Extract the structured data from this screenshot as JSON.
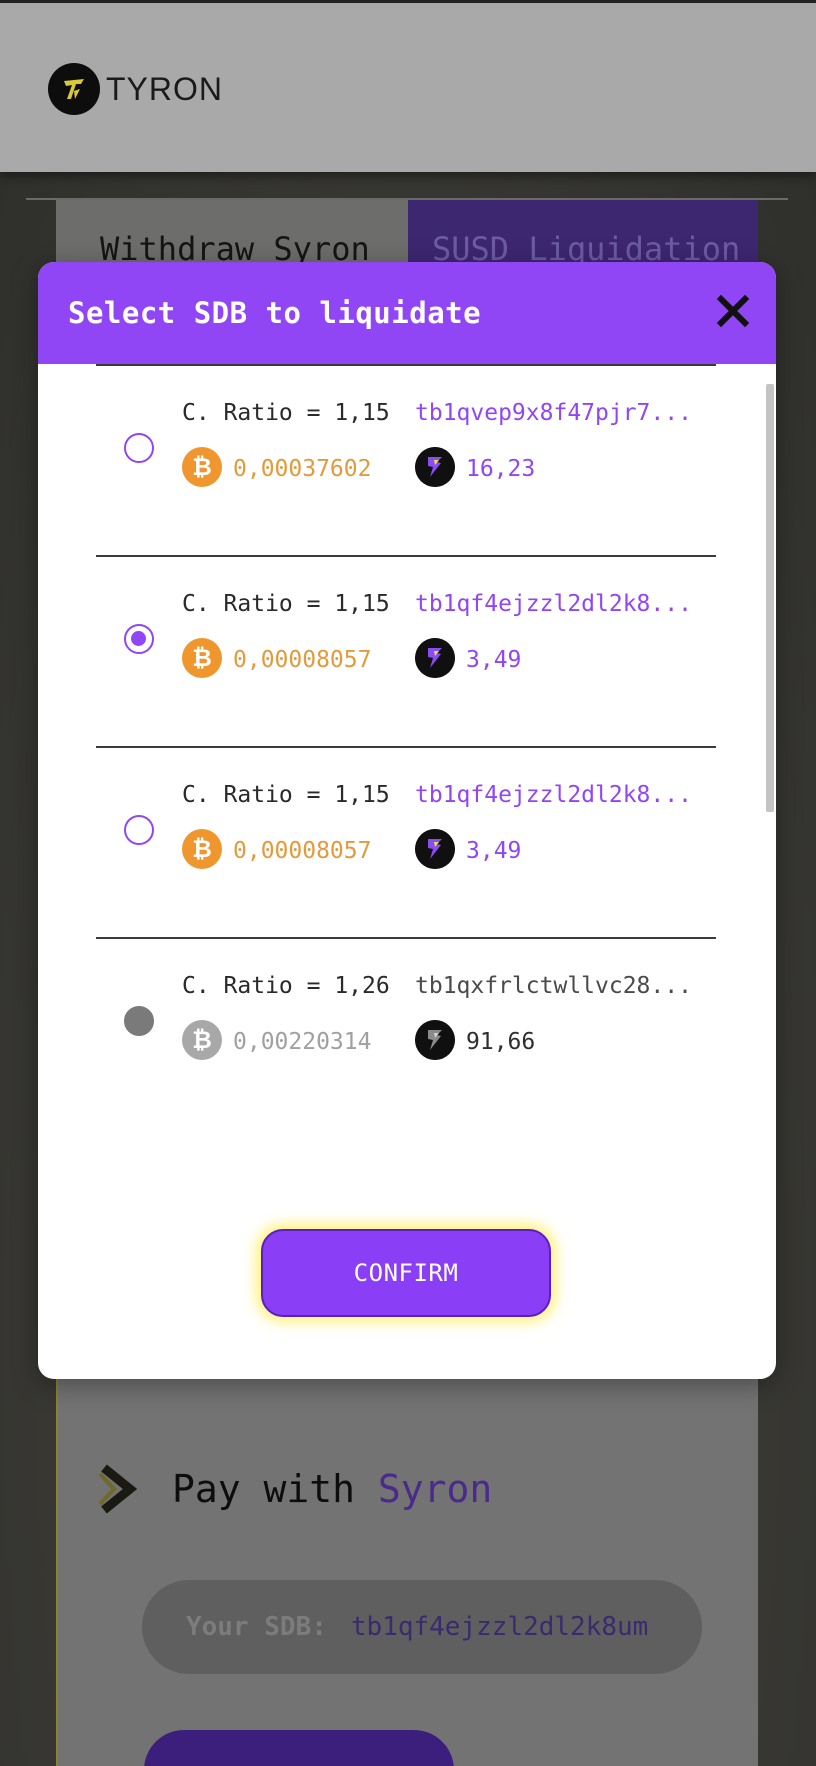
{
  "header": {
    "brand": "TYRON"
  },
  "tabs": [
    {
      "label": "Withdraw Syron",
      "active": false
    },
    {
      "label": "SUSD Liquidation",
      "active": true
    }
  ],
  "background": {
    "pay_prefix": "Pay with",
    "pay_accent": "Syron",
    "sdb_label": "Your SDB:",
    "sdb_value": "tb1qf4ejzzl2dl2k8um"
  },
  "modal": {
    "title": "Select SDB to liquidate",
    "close_icon": "close-icon",
    "accent_color": "#9146f5",
    "confirm_label": "CONFIRM",
    "items": [
      {
        "ratio": "C. Ratio = 1,15",
        "address": "tb1qvep9x8f47pjr7...",
        "btc": "0,00037602",
        "syron": "16,23",
        "state": "unchecked"
      },
      {
        "ratio": "C. Ratio = 1,15",
        "address": "tb1qf4ejzzl2dl2k8...",
        "btc": "0,00008057",
        "syron": "3,49",
        "state": "checked"
      },
      {
        "ratio": "C. Ratio = 1,15",
        "address": "tb1qf4ejzzl2dl2k8...",
        "btc": "0,00008057",
        "syron": "3,49",
        "state": "unchecked"
      },
      {
        "ratio": "C. Ratio = 1,26",
        "address": "tb1qxfrlctwllvc28...",
        "btc": "0,00220314",
        "syron": "91,66",
        "state": "disabled"
      }
    ]
  }
}
